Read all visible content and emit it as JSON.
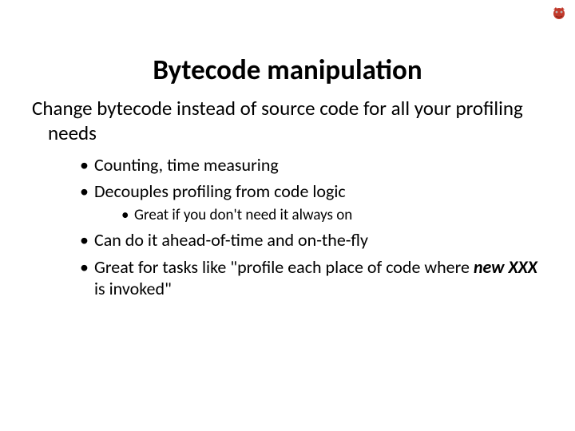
{
  "title": "Bytecode manipulation",
  "intro": "Change bytecode instead of source code for all your profiling needs",
  "bullets": {
    "b1": "Counting, time measuring",
    "b2": "Decouples profiling from code logic",
    "b2_sub": "Great if you don't need it always on",
    "b3": "Can do it ahead-of-time and on-the-fly",
    "b4_pre": "Great for tasks like \"profile each place of code where ",
    "b4_em": "new XXX",
    "b4_post": " is invoked\""
  },
  "logo_name": "mascot-logo"
}
